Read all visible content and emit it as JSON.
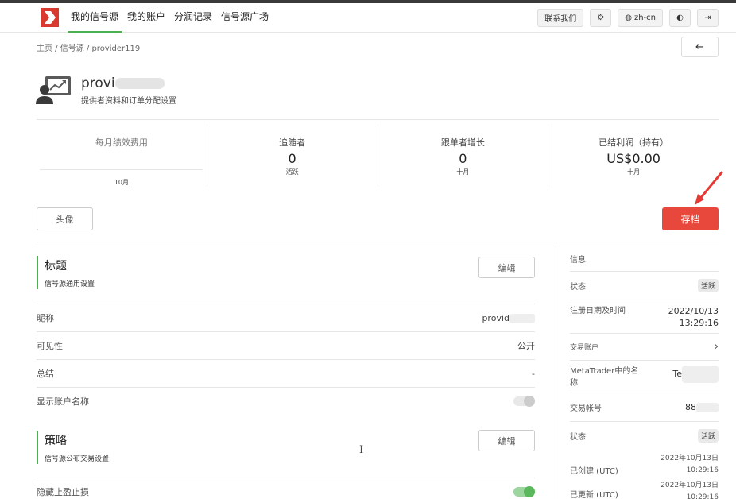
{
  "nav": {
    "links": [
      "我的信号源",
      "我的账户",
      "分润记录",
      "信号源广场"
    ],
    "contact": "联系我们",
    "lang": "zh-cn"
  },
  "breadcrumb": "主页 / 信号源 / provider119",
  "back_icon": "←",
  "provider": {
    "name": "provi",
    "subtitle": "提供者资料和订单分配设置"
  },
  "stats": [
    {
      "label": "每月绩效费用",
      "value": "",
      "sub": "",
      "chart_label": "10月"
    },
    {
      "label": "追随者",
      "value": "0",
      "sub": "活跃"
    },
    {
      "label": "跟单者增长",
      "value": "0",
      "sub": "十月"
    },
    {
      "label": "已结利润（持有）",
      "value": "US$0.00",
      "sub": "十月"
    }
  ],
  "buttons": {
    "avatar": "头像",
    "save": "存档",
    "edit": "编辑"
  },
  "sections": {
    "title": {
      "title": "标题",
      "subtitle": "信号源通用设置"
    },
    "strategy": {
      "title": "策略",
      "subtitle": "信号源公布交易设置"
    }
  },
  "rows": {
    "nickname": {
      "label": "昵称",
      "value": "provid"
    },
    "visibility": {
      "label": "可见性",
      "value": "公开"
    },
    "summary": {
      "label": "总结",
      "value": "-"
    },
    "show_account": {
      "label": "显示账户名称"
    },
    "hide_sltp": {
      "label": "隐藏止盈止损"
    }
  },
  "info": {
    "heading": "信息",
    "status_label": "状态",
    "status_value": "活跃",
    "reg_label": "注册日期及时间",
    "reg_date": "2022/10/13",
    "reg_time": "13:29:16",
    "trading_heading": "交易账户",
    "mt_label": "MetaTrader中的名称",
    "mt_value": "Te",
    "acct_label": "交易帐号",
    "acct_value": "88",
    "status2_label": "状态",
    "status2_value": "活跃",
    "created_label": "已创建 (UTC)",
    "created_date": "2022年10月13日",
    "created_time": "10:29:16",
    "updated_label": "已更新 (UTC)",
    "updated_date": "2022年10月13日",
    "updated_time": "10:29:16"
  }
}
